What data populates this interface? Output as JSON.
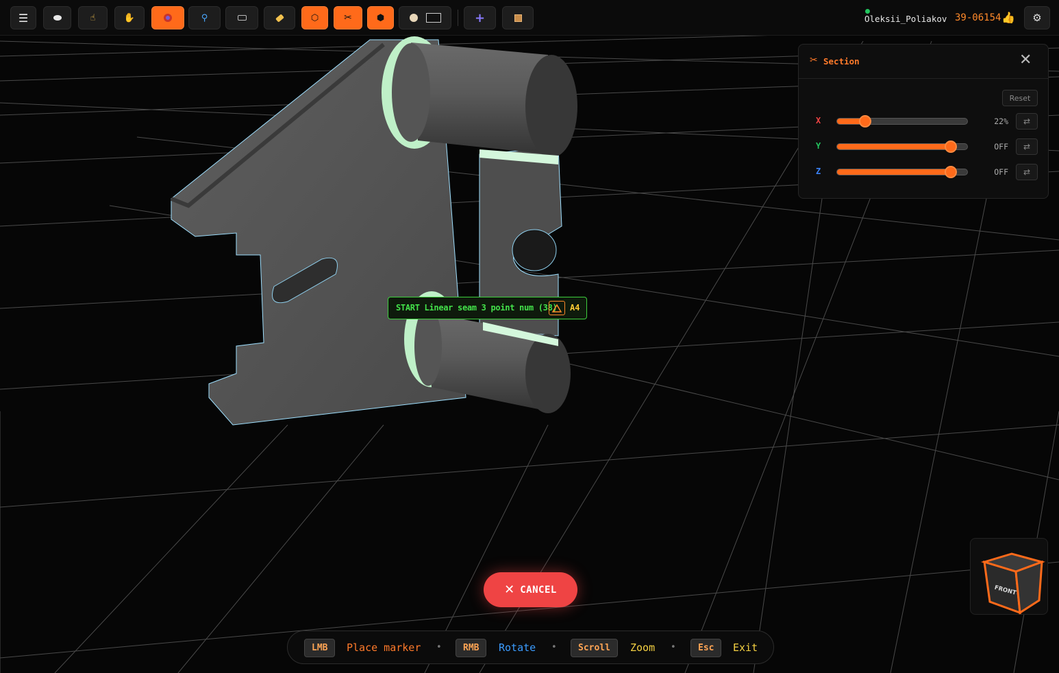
{
  "toolbar": {
    "icons": [
      "menu-icon",
      "eye-icon",
      "pointer-hand-icon",
      "pan-hand-icon",
      "target-icon",
      "magnifier-icon",
      "keyboard-icon",
      "tag-icon",
      "hexagon-outline-icon",
      "scissors-icon",
      "hexagon-filled-icon",
      "palette-icon",
      "add-icon",
      "box-icon"
    ],
    "active": [
      "target-icon",
      "hexagon-outline-icon",
      "scissors-icon",
      "hexagon-filled-icon"
    ],
    "accent": "#ff6a1a"
  },
  "user": {
    "name": "Oleksii_Poliakov",
    "code": "39-06154",
    "status_color": "#22c55e"
  },
  "section_panel": {
    "title": "Section",
    "reset_label": "Reset",
    "axes": [
      {
        "label": "X",
        "color": "#ef4444",
        "value_text": "22%",
        "level": 0.22
      },
      {
        "label": "Y",
        "color": "#22c55e",
        "value_text": "OFF",
        "level": 0.87
      },
      {
        "label": "Z",
        "color": "#3b82f6",
        "value_text": "OFF",
        "level": 0.87
      }
    ]
  },
  "marker_tooltip": {
    "text": "START Linear seam 3 point num (38)",
    "code": "A4"
  },
  "cancel_label": "CANCEL",
  "hints": [
    {
      "key": "LMB",
      "label": "Place marker",
      "color": "#ff7a2a"
    },
    {
      "key": "RMB",
      "label": "Rotate",
      "color": "#3b9cff"
    },
    {
      "key": "Scroll",
      "label": "Zoom",
      "color": "#f5d142"
    },
    {
      "key": "Esc",
      "label": "Exit",
      "color": "#f5d142"
    }
  ],
  "navcube": {
    "front_label": "FRONT"
  }
}
